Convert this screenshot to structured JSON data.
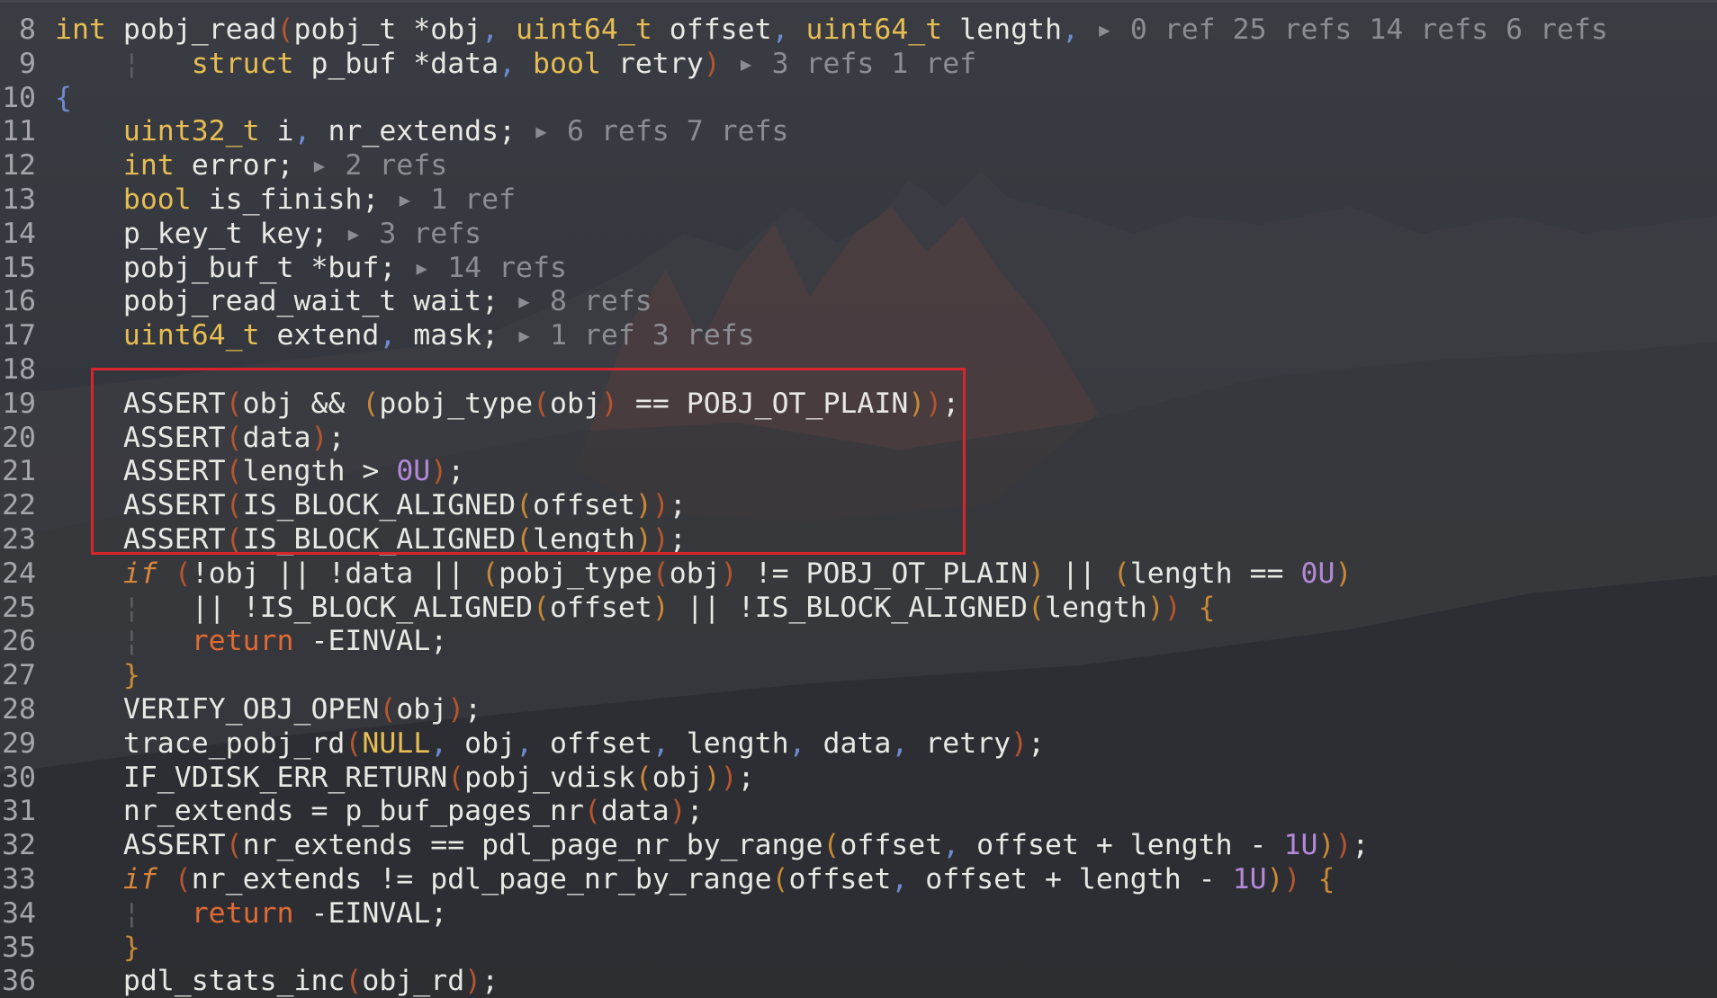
{
  "editor": {
    "lines": [
      {
        "num": "8",
        "tokens": [
          {
            "t": "int ",
            "c": "ty"
          },
          {
            "t": "pobj_read",
            "c": "nm"
          },
          {
            "t": "(",
            "c": "pt"
          },
          {
            "t": "pobj_t *obj",
            "c": "nm"
          },
          {
            "t": ", ",
            "c": "pn"
          },
          {
            "t": "uint64_t ",
            "c": "ty"
          },
          {
            "t": "offset",
            "c": "nm"
          },
          {
            "t": ", ",
            "c": "pn"
          },
          {
            "t": "uint64_t ",
            "c": "ty"
          },
          {
            "t": "length",
            "c": "nm"
          },
          {
            "t": ", ",
            "c": "pn"
          },
          {
            "t": "▸ 0 ref 25 refs 14 refs 6 refs",
            "c": "hint"
          }
        ]
      },
      {
        "num": "9",
        "tokens": [
          {
            "t": "    ¦   ",
            "c": "gd"
          },
          {
            "t": "struct ",
            "c": "ty"
          },
          {
            "t": "p_buf *data",
            "c": "nm"
          },
          {
            "t": ", ",
            "c": "pn"
          },
          {
            "t": "bool ",
            "c": "ty"
          },
          {
            "t": "retry",
            "c": "nm"
          },
          {
            "t": ") ",
            "c": "pt"
          },
          {
            "t": "▸ 3 refs 1 ref",
            "c": "hint"
          }
        ]
      },
      {
        "num": "10",
        "tokens": [
          {
            "t": "{",
            "c": "pn"
          }
        ]
      },
      {
        "num": "11",
        "tokens": [
          {
            "t": "    ",
            "c": "nm"
          },
          {
            "t": "uint32_t ",
            "c": "ty"
          },
          {
            "t": "i",
            "c": "nm"
          },
          {
            "t": ", ",
            "c": "pn"
          },
          {
            "t": "nr_extends; ",
            "c": "nm"
          },
          {
            "t": "▸ 6 refs 7 refs",
            "c": "hint"
          }
        ]
      },
      {
        "num": "12",
        "tokens": [
          {
            "t": "    ",
            "c": "nm"
          },
          {
            "t": "int ",
            "c": "ty"
          },
          {
            "t": "error; ",
            "c": "nm"
          },
          {
            "t": "▸ 2 refs",
            "c": "hint"
          }
        ]
      },
      {
        "num": "13",
        "tokens": [
          {
            "t": "    ",
            "c": "nm"
          },
          {
            "t": "bool ",
            "c": "ty"
          },
          {
            "t": "is_finish; ",
            "c": "nm"
          },
          {
            "t": "▸ 1 ref",
            "c": "hint"
          }
        ]
      },
      {
        "num": "14",
        "tokens": [
          {
            "t": "    p_key_t key; ",
            "c": "nm"
          },
          {
            "t": "▸ 3 refs",
            "c": "hint"
          }
        ]
      },
      {
        "num": "15",
        "tokens": [
          {
            "t": "    pobj_buf_t *buf; ",
            "c": "nm"
          },
          {
            "t": "▸ 14 refs",
            "c": "hint"
          }
        ]
      },
      {
        "num": "16",
        "tokens": [
          {
            "t": "    pobj_read_wait_t wait; ",
            "c": "nm"
          },
          {
            "t": "▸ 8 refs",
            "c": "hint"
          }
        ]
      },
      {
        "num": "17",
        "tokens": [
          {
            "t": "    ",
            "c": "nm"
          },
          {
            "t": "uint64_t ",
            "c": "ty"
          },
          {
            "t": "extend",
            "c": "nm"
          },
          {
            "t": ", ",
            "c": "pn"
          },
          {
            "t": "mask; ",
            "c": "nm"
          },
          {
            "t": "▸ 1 ref 3 refs",
            "c": "hint"
          }
        ]
      },
      {
        "num": "18",
        "tokens": []
      },
      {
        "num": "19",
        "tokens": [
          {
            "t": "    ASSERT",
            "c": "nm"
          },
          {
            "t": "(",
            "c": "pt"
          },
          {
            "t": "obj && ",
            "c": "nm"
          },
          {
            "t": "(",
            "c": "br"
          },
          {
            "t": "pobj_type",
            "c": "nm"
          },
          {
            "t": "(",
            "c": "pt"
          },
          {
            "t": "obj",
            "c": "nm"
          },
          {
            "t": ")",
            "c": "pt"
          },
          {
            "t": " == POBJ_OT_PLAIN",
            "c": "nm"
          },
          {
            "t": ")",
            "c": "br"
          },
          {
            "t": ")",
            "c": "pt"
          },
          {
            "t": ";",
            "c": "nm"
          }
        ]
      },
      {
        "num": "20",
        "tokens": [
          {
            "t": "    ASSERT",
            "c": "nm"
          },
          {
            "t": "(",
            "c": "pt"
          },
          {
            "t": "data",
            "c": "nm"
          },
          {
            "t": ")",
            "c": "pt"
          },
          {
            "t": ";",
            "c": "nm"
          }
        ]
      },
      {
        "num": "21",
        "tokens": [
          {
            "t": "    ASSERT",
            "c": "nm"
          },
          {
            "t": "(",
            "c": "pt"
          },
          {
            "t": "length > ",
            "c": "nm"
          },
          {
            "t": "0U",
            "c": "num"
          },
          {
            "t": ")",
            "c": "pt"
          },
          {
            "t": ";",
            "c": "nm"
          }
        ]
      },
      {
        "num": "22",
        "tokens": [
          {
            "t": "    ASSERT",
            "c": "nm"
          },
          {
            "t": "(",
            "c": "pt"
          },
          {
            "t": "IS_BLOCK_ALIGNED",
            "c": "nm"
          },
          {
            "t": "(",
            "c": "br"
          },
          {
            "t": "offset",
            "c": "nm"
          },
          {
            "t": ")",
            "c": "br"
          },
          {
            "t": ")",
            "c": "pt"
          },
          {
            "t": ";",
            "c": "nm"
          }
        ]
      },
      {
        "num": "23",
        "tokens": [
          {
            "t": "    ASSERT",
            "c": "nm"
          },
          {
            "t": "(",
            "c": "pt"
          },
          {
            "t": "IS_BLOCK_ALIGNED",
            "c": "nm"
          },
          {
            "t": "(",
            "c": "br"
          },
          {
            "t": "length",
            "c": "nm"
          },
          {
            "t": ")",
            "c": "br"
          },
          {
            "t": ")",
            "c": "pt"
          },
          {
            "t": ";",
            "c": "nm"
          }
        ]
      },
      {
        "num": "24",
        "tokens": [
          {
            "t": "    ",
            "c": "nm"
          },
          {
            "t": "if",
            "c": "kw"
          },
          {
            "t": " (",
            "c": "pt"
          },
          {
            "t": "!obj || !data || ",
            "c": "nm"
          },
          {
            "t": "(",
            "c": "br"
          },
          {
            "t": "pobj_type",
            "c": "nm"
          },
          {
            "t": "(",
            "c": "pt"
          },
          {
            "t": "obj",
            "c": "nm"
          },
          {
            "t": ")",
            "c": "pt"
          },
          {
            "t": " != POBJ_OT_PLAIN",
            "c": "nm"
          },
          {
            "t": ")",
            "c": "br"
          },
          {
            "t": " || ",
            "c": "nm"
          },
          {
            "t": "(",
            "c": "br"
          },
          {
            "t": "length == ",
            "c": "nm"
          },
          {
            "t": "0U",
            "c": "num"
          },
          {
            "t": ")",
            "c": "br"
          }
        ]
      },
      {
        "num": "25",
        "tokens": [
          {
            "t": "    ¦   ",
            "c": "gd"
          },
          {
            "t": "|| !IS_BLOCK_ALIGNED",
            "c": "nm"
          },
          {
            "t": "(",
            "c": "br"
          },
          {
            "t": "offset",
            "c": "nm"
          },
          {
            "t": ")",
            "c": "br"
          },
          {
            "t": " || !IS_BLOCK_ALIGNED",
            "c": "nm"
          },
          {
            "t": "(",
            "c": "br"
          },
          {
            "t": "length",
            "c": "nm"
          },
          {
            "t": ")",
            "c": "br"
          },
          {
            "t": ")",
            "c": "pt"
          },
          {
            "t": " {",
            "c": "br"
          }
        ]
      },
      {
        "num": "26",
        "tokens": [
          {
            "t": "    ¦   ",
            "c": "gd"
          },
          {
            "t": "return",
            "c": "rt"
          },
          {
            "t": " -EINVAL;",
            "c": "nm"
          }
        ]
      },
      {
        "num": "27",
        "tokens": [
          {
            "t": "    ",
            "c": "nm"
          },
          {
            "t": "}",
            "c": "br"
          }
        ]
      },
      {
        "num": "28",
        "tokens": [
          {
            "t": "    VERIFY_OBJ_OPEN",
            "c": "nm"
          },
          {
            "t": "(",
            "c": "pt"
          },
          {
            "t": "obj",
            "c": "nm"
          },
          {
            "t": ")",
            "c": "pt"
          },
          {
            "t": ";",
            "c": "nm"
          }
        ]
      },
      {
        "num": "29",
        "tokens": [
          {
            "t": "    trace_pobj_rd",
            "c": "nm"
          },
          {
            "t": "(",
            "c": "pt"
          },
          {
            "t": "NULL",
            "c": "ty"
          },
          {
            "t": ", ",
            "c": "pn"
          },
          {
            "t": "obj",
            "c": "nm"
          },
          {
            "t": ", ",
            "c": "pn"
          },
          {
            "t": "offset",
            "c": "nm"
          },
          {
            "t": ", ",
            "c": "pn"
          },
          {
            "t": "length",
            "c": "nm"
          },
          {
            "t": ", ",
            "c": "pn"
          },
          {
            "t": "data",
            "c": "nm"
          },
          {
            "t": ", ",
            "c": "pn"
          },
          {
            "t": "retry",
            "c": "nm"
          },
          {
            "t": ")",
            "c": "pt"
          },
          {
            "t": ";",
            "c": "nm"
          }
        ]
      },
      {
        "num": "30",
        "tokens": [
          {
            "t": "    IF_VDISK_ERR_RETURN",
            "c": "nm"
          },
          {
            "t": "(",
            "c": "pt"
          },
          {
            "t": "pobj_vdisk",
            "c": "nm"
          },
          {
            "t": "(",
            "c": "br"
          },
          {
            "t": "obj",
            "c": "nm"
          },
          {
            "t": ")",
            "c": "br"
          },
          {
            "t": ")",
            "c": "pt"
          },
          {
            "t": ";",
            "c": "nm"
          }
        ]
      },
      {
        "num": "31",
        "tokens": [
          {
            "t": "    nr_extends = p_buf_pages_nr",
            "c": "nm"
          },
          {
            "t": "(",
            "c": "pt"
          },
          {
            "t": "data",
            "c": "nm"
          },
          {
            "t": ")",
            "c": "pt"
          },
          {
            "t": ";",
            "c": "nm"
          }
        ]
      },
      {
        "num": "32",
        "tokens": [
          {
            "t": "    ASSERT",
            "c": "nm"
          },
          {
            "t": "(",
            "c": "pt"
          },
          {
            "t": "nr_extends == pdl_page_nr_by_range",
            "c": "nm"
          },
          {
            "t": "(",
            "c": "br"
          },
          {
            "t": "offset",
            "c": "nm"
          },
          {
            "t": ", ",
            "c": "pn"
          },
          {
            "t": "offset + length - ",
            "c": "nm"
          },
          {
            "t": "1U",
            "c": "num"
          },
          {
            "t": ")",
            "c": "br"
          },
          {
            "t": ")",
            "c": "pt"
          },
          {
            "t": ";",
            "c": "nm"
          }
        ]
      },
      {
        "num": "33",
        "tokens": [
          {
            "t": "    ",
            "c": "nm"
          },
          {
            "t": "if",
            "c": "kw"
          },
          {
            "t": " (",
            "c": "pt"
          },
          {
            "t": "nr_extends != pdl_page_nr_by_range",
            "c": "nm"
          },
          {
            "t": "(",
            "c": "br"
          },
          {
            "t": "offset",
            "c": "nm"
          },
          {
            "t": ", ",
            "c": "pn"
          },
          {
            "t": "offset + length - ",
            "c": "nm"
          },
          {
            "t": "1U",
            "c": "num"
          },
          {
            "t": ")",
            "c": "br"
          },
          {
            "t": ")",
            "c": "pt"
          },
          {
            "t": " {",
            "c": "br"
          }
        ]
      },
      {
        "num": "34",
        "tokens": [
          {
            "t": "    ¦   ",
            "c": "gd"
          },
          {
            "t": "return",
            "c": "rt"
          },
          {
            "t": " -EINVAL;",
            "c": "nm"
          }
        ]
      },
      {
        "num": "35",
        "tokens": [
          {
            "t": "    ",
            "c": "nm"
          },
          {
            "t": "}",
            "c": "br"
          }
        ]
      },
      {
        "num": "36",
        "tokens": [
          {
            "t": "    pdl_stats_inc",
            "c": "nm"
          },
          {
            "t": "(",
            "c": "pt"
          },
          {
            "t": "obj_rd",
            "c": "nm"
          },
          {
            "t": ")",
            "c": "pt"
          },
          {
            "t": ";",
            "c": "nm"
          }
        ]
      }
    ]
  },
  "highlight": {
    "from_line": "19",
    "to_line": "23",
    "color": "#d7262b"
  },
  "colors": {
    "type": "#e6bd53",
    "keyword": "#d8863b",
    "return": "#e06a33",
    "number": "#b488d8",
    "punct": "#6f8bd0",
    "paren": "#b5562e",
    "bracket": "#c98936",
    "hint": "#8b8d93",
    "text": "#e8e8e4",
    "line_number": "#a5a6ab"
  }
}
